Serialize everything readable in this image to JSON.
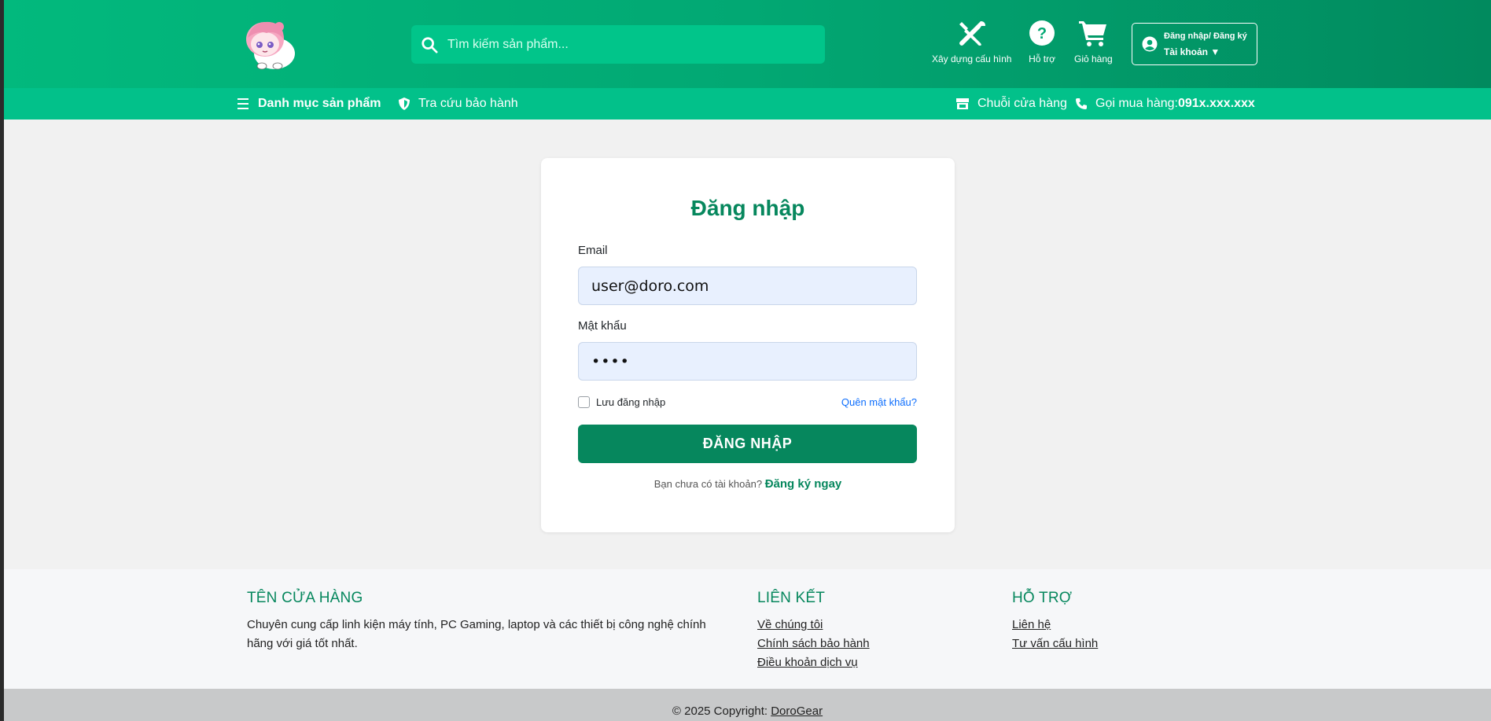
{
  "header": {
    "search_placeholder": "Tìm kiếm sản phẩm...",
    "actions": {
      "build_pc": "Xây dựng cấu hình",
      "support": "Hỗ trợ",
      "cart": "Giỏ hàng"
    },
    "account": {
      "line1": "Đăng nhập/ Đăng ký",
      "line2": "Tài khoản ▼"
    }
  },
  "navbar": {
    "categories": "Danh mục sản phẩm",
    "warranty": "Tra cứu bảo hành",
    "stores": "Chuỗi cửa hàng",
    "hotline_label": "Gọi mua hàng: ",
    "hotline_number": "091x.xxx.xxx"
  },
  "login": {
    "title": "Đăng nhập",
    "email_label": "Email",
    "email_value": "user@doro.com",
    "password_label": "Mật khẩu",
    "password_value": "••••",
    "remember_label": "Lưu đăng nhập",
    "forgot_label": "Quên mật khẩu?",
    "submit_label": "ĐĂNG NHẬP",
    "signup_prompt": "Bạn chưa có tài khoản?",
    "signup_link": "Đăng ký ngay"
  },
  "footer": {
    "store": {
      "title": "TÊN CỬA HÀNG",
      "description": "Chuyên cung cấp linh kiện máy tính, PC Gaming, laptop và các thiết bị công nghệ chính hãng với giá tốt nhất."
    },
    "links": {
      "title": "LIÊN KẾT",
      "items": [
        "Về chúng tôi",
        "Chính sách bảo hành",
        "Điều khoản dịch vụ"
      ]
    },
    "support": {
      "title": "HỖ TRỢ",
      "items": [
        "Liên hệ",
        "Tư vấn cấu hình"
      ]
    },
    "copyright_prefix": "© 2025 Copyright: ",
    "copyright_brand": "DoroGear"
  },
  "colors": {
    "brand": "#06875d",
    "header_gradient_start": "#02b97d",
    "navbar": "#02c18a",
    "input_bg": "#e8f0fe",
    "link": "#0d6efd"
  },
  "icons": [
    "logo-mascot",
    "search-icon",
    "tools-icon",
    "help-icon",
    "cart-icon",
    "user-circle-icon",
    "menu-icon",
    "shield-icon",
    "store-icon",
    "phone-icon"
  ]
}
